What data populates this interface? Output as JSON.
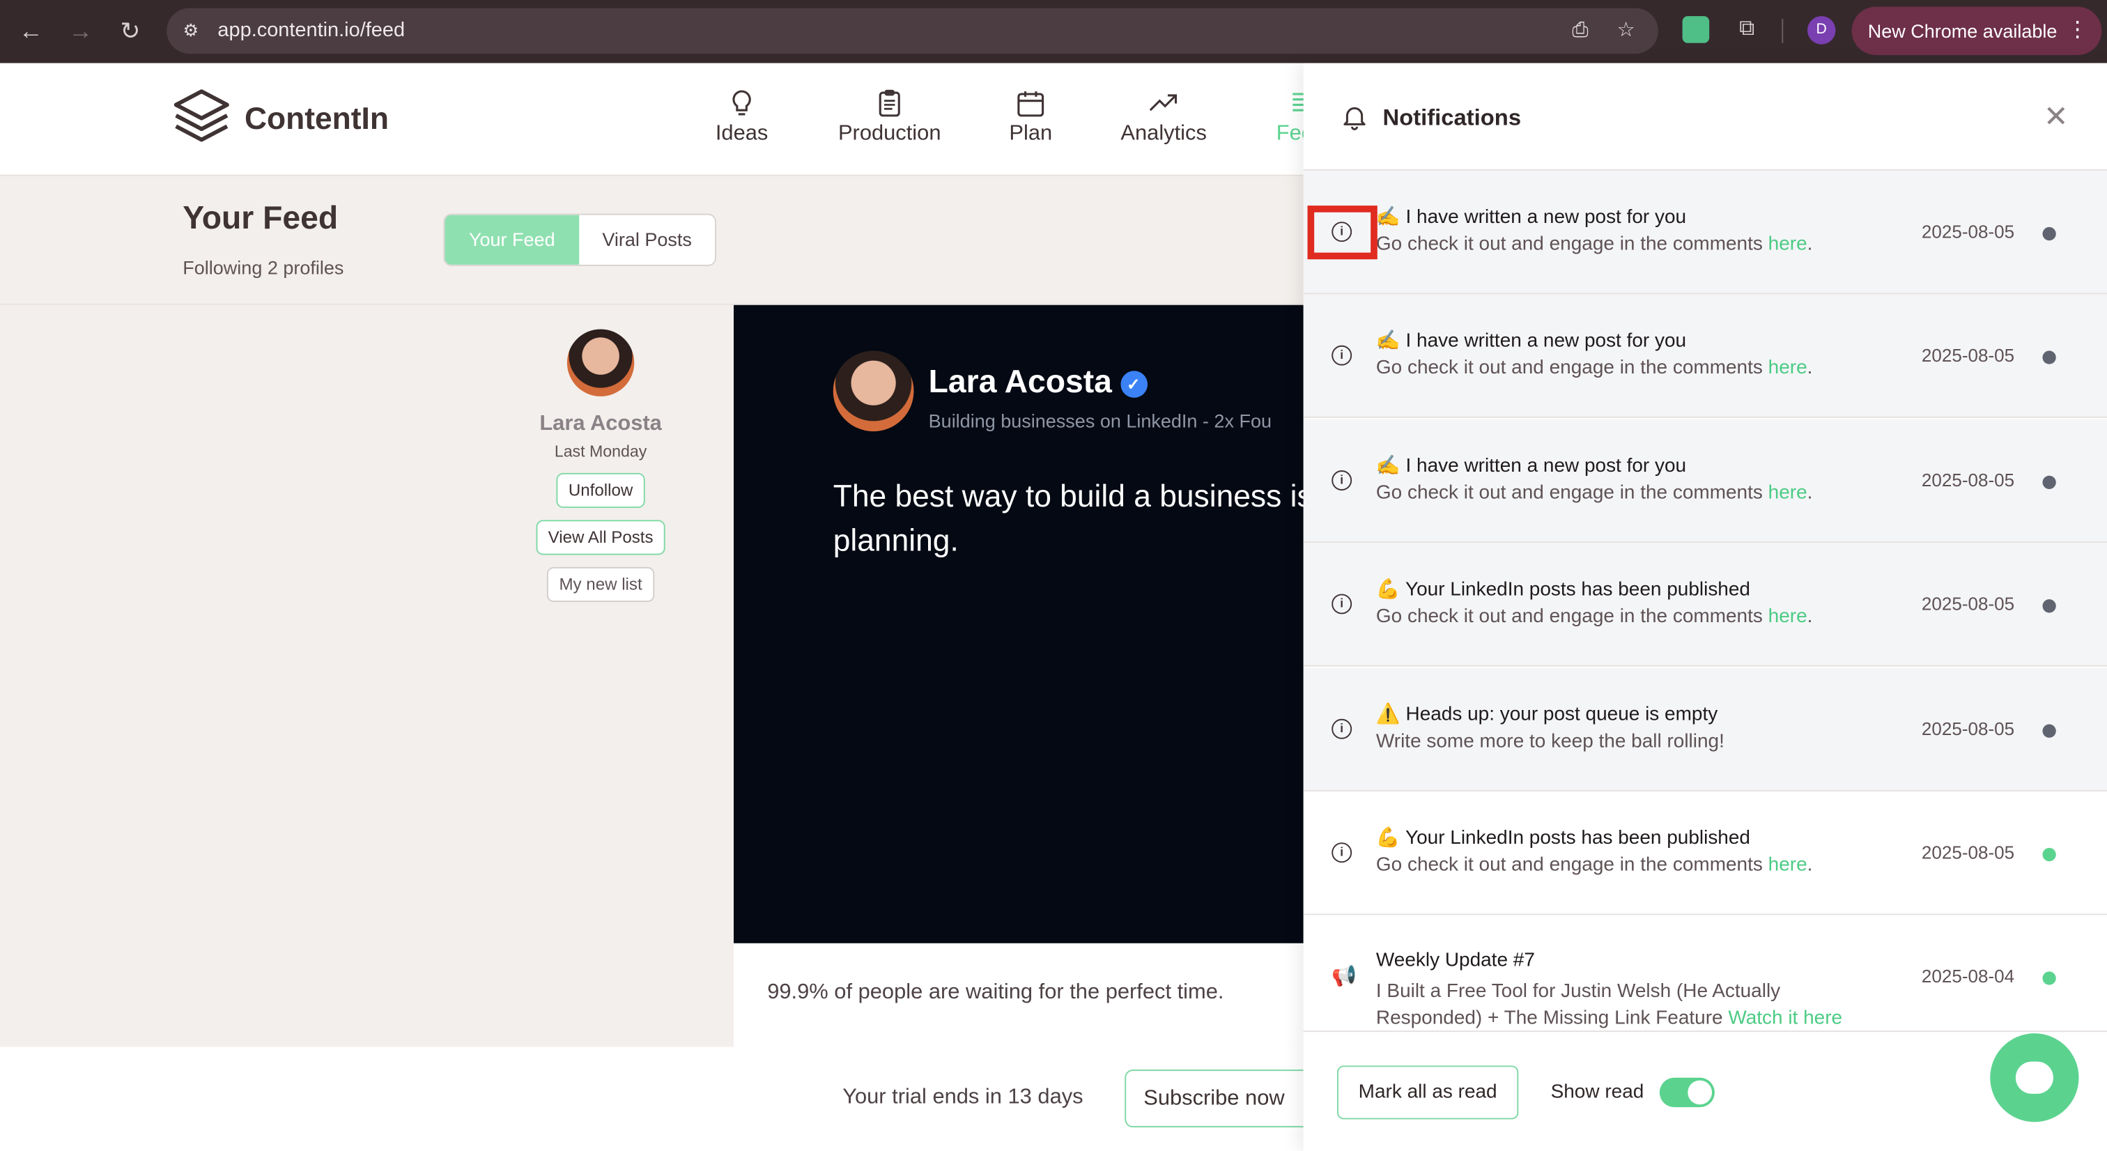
{
  "browser": {
    "url": "app.contentin.io/feed",
    "profile_initial": "D",
    "update_label": "New Chrome available"
  },
  "app": {
    "name": "ContentIn",
    "nav": [
      {
        "label": "Ideas",
        "icon": "lightbulb-icon"
      },
      {
        "label": "Production",
        "icon": "clipboard-icon"
      },
      {
        "label": "Plan",
        "icon": "calendar-icon"
      },
      {
        "label": "Analytics",
        "icon": "trend-icon"
      },
      {
        "label": "Feed",
        "icon": "feed-icon"
      }
    ]
  },
  "feed": {
    "title": "Your Feed",
    "subtitle": "Following 2 profiles",
    "tabs": [
      "Your Feed",
      "Viral Posts"
    ],
    "active_tab": "Your Feed",
    "profile": {
      "name": "Lara Acosta",
      "when": "Last Monday",
      "unfollow": "Unfollow",
      "view_all": "View All Posts",
      "list": "My new list"
    },
    "post": {
      "author": "Lara Acosta",
      "headline": "Building businesses on LinkedIn - 2x Fou",
      "text": "The best way to build a business is stop planning.",
      "caption": "99.9% of people are waiting for the perfect time."
    }
  },
  "trial": {
    "text": "Your trial ends in 13 days",
    "subscribe": "Subscribe now"
  },
  "notifications": {
    "title": "Notifications",
    "items": [
      {
        "emoji": "✍️",
        "title": "I have written a new post for you",
        "body": "Go check it out and engage in the comments ",
        "link": "here",
        "tail": ".",
        "date": "2025-08-05",
        "read": false,
        "icon": "info-icon"
      },
      {
        "emoji": "✍️",
        "title": "I have written a new post for you",
        "body": "Go check it out and engage in the comments ",
        "link": "here",
        "tail": ".",
        "date": "2025-08-05",
        "read": false,
        "icon": "info-icon"
      },
      {
        "emoji": "✍️",
        "title": "I have written a new post for you",
        "body": "Go check it out and engage in the comments ",
        "link": "here",
        "tail": ".",
        "date": "2025-08-05",
        "read": false,
        "icon": "info-icon"
      },
      {
        "emoji": "💪",
        "title": "Your LinkedIn posts has been published",
        "body": "Go check it out and engage in the comments ",
        "link": "here",
        "tail": ".",
        "date": "2025-08-05",
        "read": false,
        "icon": "info-icon"
      },
      {
        "emoji": "⚠️",
        "title": "Heads up: your post queue is empty",
        "body": "Write some more to keep the ball rolling!",
        "link": "",
        "tail": "",
        "date": "2025-08-05",
        "read": false,
        "icon": "info-icon"
      },
      {
        "emoji": "💪",
        "title": "Your LinkedIn posts has been published",
        "body": "Go check it out and engage in the comments ",
        "link": "here",
        "tail": ".",
        "date": "2025-08-05",
        "read": true,
        "icon": "info-icon"
      },
      {
        "emoji": "",
        "title": "Weekly Update #7",
        "body": "I Built a Free Tool for Justin Welsh (He Actually",
        "body2": "Responded) + The Missing Link Feature ",
        "link": "Watch it here",
        "tail": "",
        "date": "2025-08-04",
        "read": true,
        "icon": "megaphone-icon"
      }
    ],
    "mark_all": "Mark all as read",
    "show_read": "Show read",
    "show_read_on": true
  },
  "colors": {
    "accent": "#5bd38f",
    "unread_dot": "#5f6470",
    "read_dot": "#5bd38f",
    "highlight": "#e02b20"
  }
}
